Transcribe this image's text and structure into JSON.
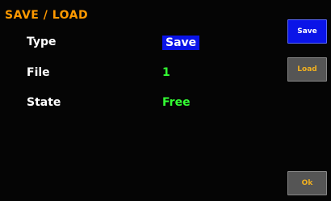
{
  "header": {
    "title": "SAVE / LOAD"
  },
  "rows": [
    {
      "label": "Type",
      "value": "Save"
    },
    {
      "label": "File",
      "value": "1"
    },
    {
      "label": "State",
      "value": "Free"
    }
  ],
  "side_buttons": {
    "save_label": "Save",
    "load_label": "Load",
    "ok_label": "Ok"
  },
  "colors": {
    "background": "#050505",
    "title": "#ff9900",
    "label": "#ffffff",
    "value_green": "#33ff33",
    "highlight_blue": "#0a14e8",
    "button_gray": "#555555",
    "button_text_orange": "#f0b020"
  }
}
